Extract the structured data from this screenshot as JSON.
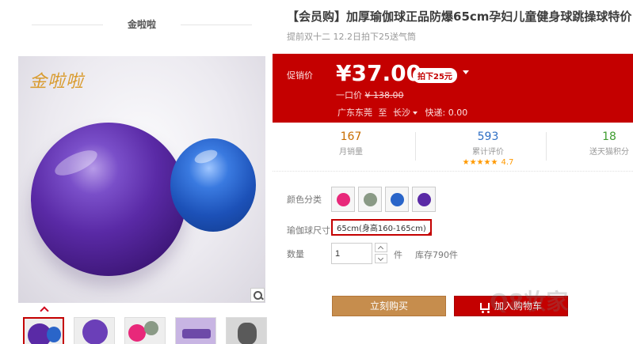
{
  "store": {
    "name": "金啦啦"
  },
  "gallery": {
    "brand_logo_text": "金啦啦",
    "thumbnails": [
      {
        "id": "thumb-1"
      },
      {
        "id": "thumb-2"
      },
      {
        "id": "thumb-3"
      },
      {
        "id": "thumb-4"
      },
      {
        "id": "thumb-5"
      }
    ]
  },
  "product": {
    "title": "【会员购】加厚瑜伽球正品防爆65cm孕妇儿童健身球跳操球特价",
    "subtitle": "提前双十二 12.2日拍下25送气筒"
  },
  "price": {
    "label": "促销价",
    "current": "¥37.00",
    "coupon": "拍下25元",
    "original_label": "一口价",
    "original_value": "¥ 138.00",
    "ship_from": "广东东莞",
    "ship_to_label": "至",
    "ship_to": "长沙",
    "shipping": "快递: 0.00"
  },
  "stats": {
    "sales": {
      "value": "167",
      "label": "月销量"
    },
    "reviews": {
      "value": "593",
      "label": "累计评价",
      "stars": "★★★★★",
      "rating": "4.7"
    },
    "points": {
      "value": "18",
      "label": "送天猫积分"
    }
  },
  "options": {
    "color_label": "颜色分类",
    "colors": [
      "#e8287a",
      "#8a9a86",
      "#2a65c9",
      "#5a2aa6"
    ],
    "size_label": "瑜伽球尺寸",
    "size_selected": "65cm(身高160-165cm)",
    "qty_label": "数量",
    "qty_value": "1",
    "qty_unit": "件",
    "stock": "库存790件"
  },
  "actions": {
    "buy_now": "立刻购买",
    "add_cart": "加入购物车"
  },
  "watermark": "Q8妆家"
}
